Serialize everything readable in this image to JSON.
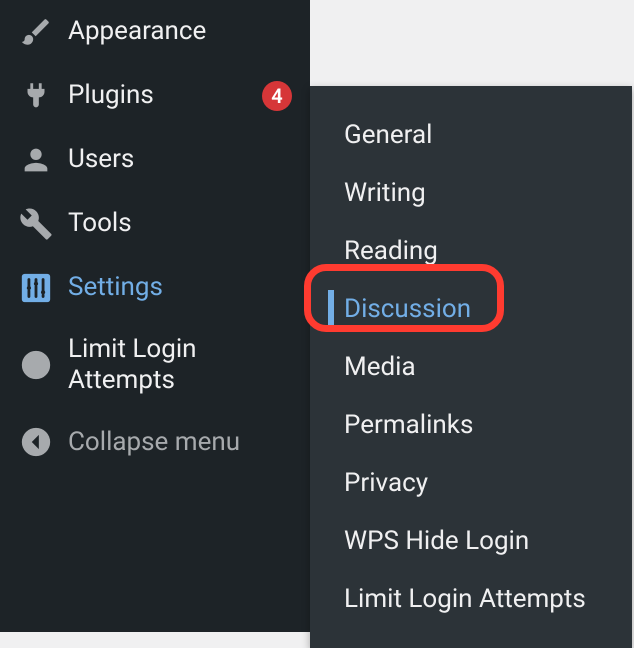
{
  "sidebar": {
    "items": [
      {
        "label": "Appearance"
      },
      {
        "label": "Plugins",
        "badge": "4"
      },
      {
        "label": "Users"
      },
      {
        "label": "Tools"
      },
      {
        "label": "Settings"
      },
      {
        "label": "Limit Login Attempts"
      },
      {
        "label": "Collapse menu"
      }
    ]
  },
  "submenu": {
    "items": [
      {
        "label": "General"
      },
      {
        "label": "Writing"
      },
      {
        "label": "Reading"
      },
      {
        "label": "Discussion"
      },
      {
        "label": "Media"
      },
      {
        "label": "Permalinks"
      },
      {
        "label": "Privacy"
      },
      {
        "label": "WPS Hide Login"
      },
      {
        "label": "Limit Login Attempts"
      }
    ]
  }
}
